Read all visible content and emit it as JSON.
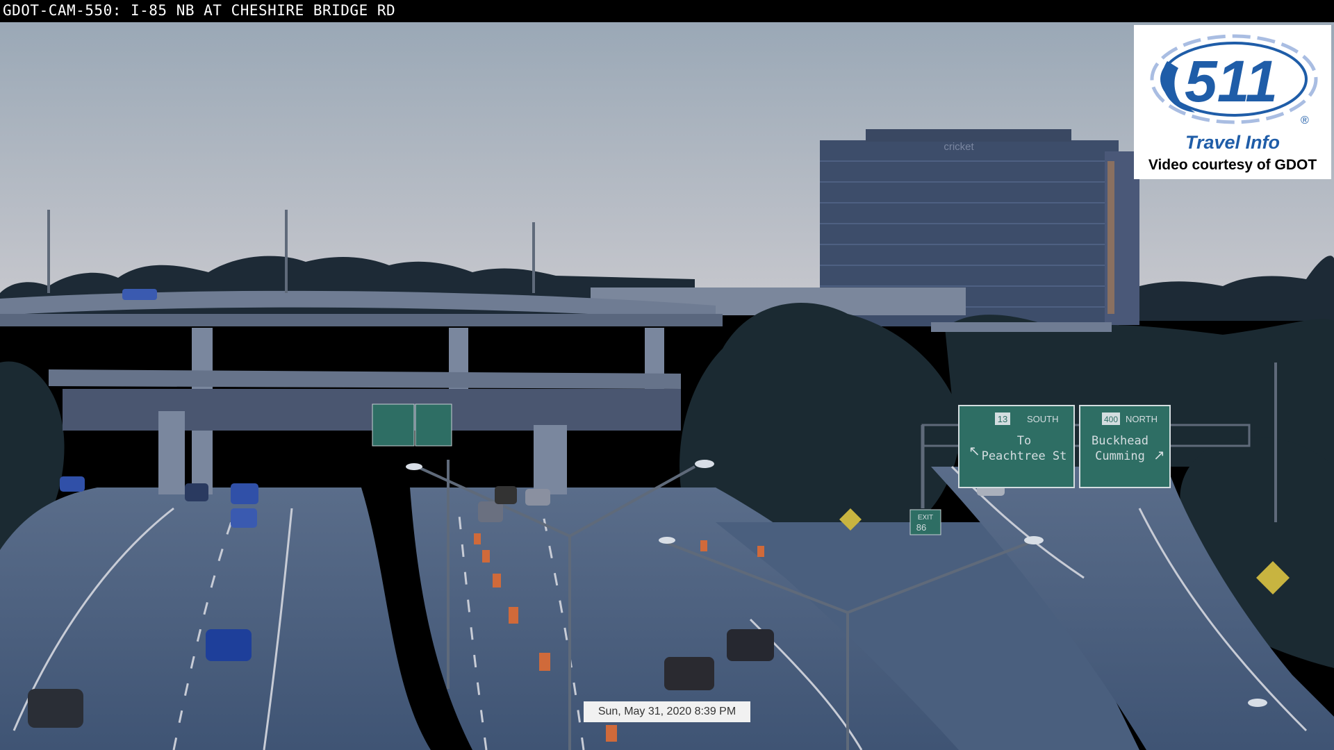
{
  "camera": {
    "title": "GDOT-CAM-550: I-85 NB AT CHESHIRE BRIDGE RD",
    "timestamp": "Sun, May 31, 2020  8:39 PM"
  },
  "logo": {
    "number": "511",
    "registered": "®",
    "tagline": "Travel Info",
    "credit": "Video courtesy of GDOT"
  },
  "building": {
    "sign": "cricket"
  },
  "signs": {
    "left": {
      "route": "13",
      "direction": "SOUTH",
      "line1": "To",
      "line2": "Peachtree St"
    },
    "right": {
      "route": "400",
      "direction": "NORTH",
      "line1": "Buckhead",
      "line2": "Cumming"
    },
    "exit_label": "EXIT",
    "exit_number": "86"
  },
  "colors": {
    "sky_top": "#9aa8b6",
    "sky_bottom": "#c4c6cc",
    "road": "#4a5f7e",
    "sign_green": "#2e6e64",
    "logo_blue": "#1f5da8"
  }
}
